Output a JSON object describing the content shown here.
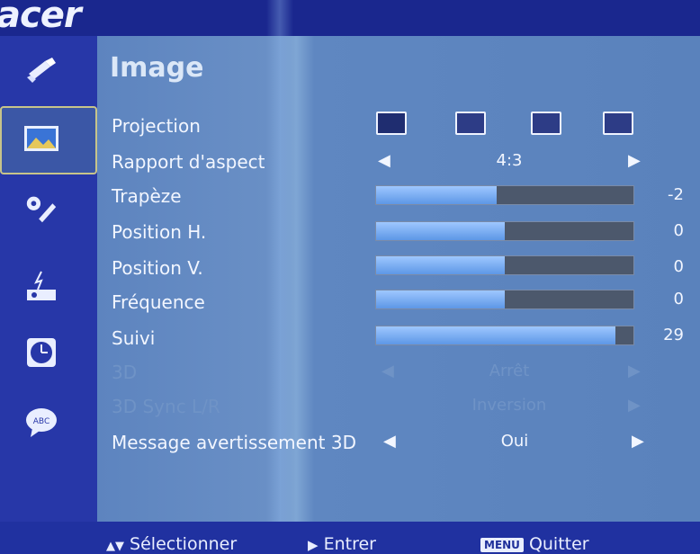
{
  "brand": {
    "logo_text": "acer"
  },
  "sidebar": {
    "items": [
      {
        "name": "color-brush"
      },
      {
        "name": "image",
        "selected": true
      },
      {
        "name": "settings-tools"
      },
      {
        "name": "projector-management"
      },
      {
        "name": "timer"
      },
      {
        "name": "language"
      }
    ]
  },
  "menu": {
    "title": "Image",
    "rows": [
      {
        "label": "Projection"
      },
      {
        "label": "Rapport d'aspect",
        "value": "4:3"
      },
      {
        "label": "Trapèze",
        "value": "-2",
        "level_fraction": 0.47
      },
      {
        "label": "Position H.",
        "value": "0",
        "level_fraction": 0.5
      },
      {
        "label": "Position V.",
        "value": "0",
        "level_fraction": 0.5
      },
      {
        "label": "Fréquence",
        "value": "0",
        "level_fraction": 0.5
      },
      {
        "label": "Suivi",
        "value": "29",
        "level_fraction": 0.93
      },
      {
        "label": "3D",
        "value": "Arrêt",
        "disabled": true
      },
      {
        "label": "3D Sync L/R",
        "value": "Inversion",
        "disabled": true
      },
      {
        "label": "Message avertissement 3D",
        "value": "Oui"
      }
    ]
  },
  "footer": {
    "select_label": "Sélectionner",
    "enter_label": "Entrer",
    "menu_badge": "MENU",
    "quit_label": "Quitter"
  },
  "colors": {
    "panel": "#5d84bf",
    "sidebar": "#2737a8",
    "bar_fill": "#6fa8f2",
    "bar_track": "#4c586c"
  }
}
